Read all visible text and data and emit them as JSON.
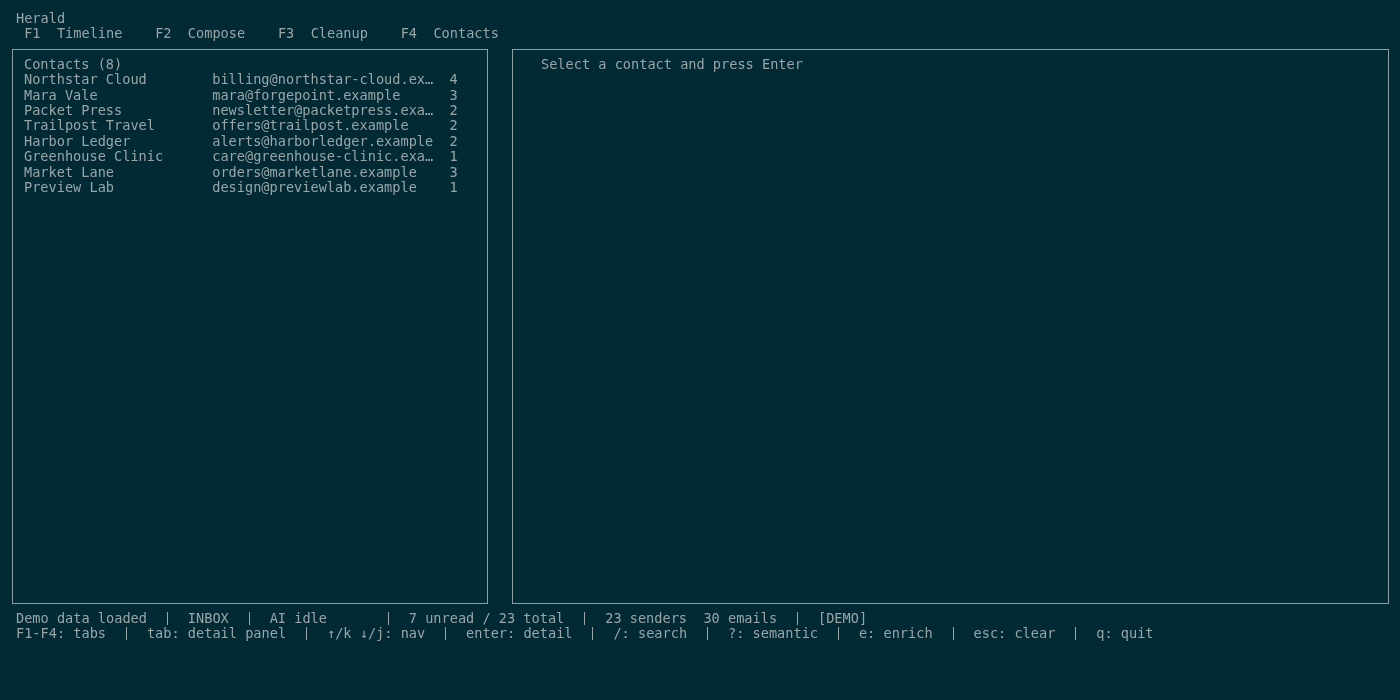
{
  "app": {
    "title": "Herald"
  },
  "tabs": [
    {
      "key": "F1",
      "label": "Timeline"
    },
    {
      "key": "F2",
      "label": "Compose"
    },
    {
      "key": "F3",
      "label": "Cleanup"
    },
    {
      "key": "F4",
      "label": "Contacts"
    }
  ],
  "contacts_panel": {
    "title": "Contacts (8)",
    "rows": [
      {
        "name": "Northstar Cloud",
        "email": "billing@northstar-cloud.ex…",
        "count": "4"
      },
      {
        "name": "Mara Vale",
        "email": "mara@forgepoint.example",
        "count": "3"
      },
      {
        "name": "Packet Press",
        "email": "newsletter@packetpress.exa…",
        "count": "2"
      },
      {
        "name": "Trailpost Travel",
        "email": "offers@trailpost.example",
        "count": "2"
      },
      {
        "name": "Harbor Ledger",
        "email": "alerts@harborledger.example",
        "count": "2"
      },
      {
        "name": "Greenhouse Clinic",
        "email": "care@greenhouse-clinic.exa…",
        "count": "1"
      },
      {
        "name": "Market Lane",
        "email": "orders@marketlane.example",
        "count": "3"
      },
      {
        "name": "Preview Lab",
        "email": "design@previewlab.example",
        "count": "1"
      }
    ]
  },
  "detail_panel": {
    "message": "Select a contact and press Enter"
  },
  "status_bar": {
    "message": "Demo data loaded",
    "mailbox": "INBOX",
    "ai_status": "AI idle",
    "unread": "7 unread / 23 total",
    "senders": "23 senders",
    "emails": "30 emails",
    "mode": "[DEMO]"
  },
  "key_hints": [
    "F1-F4: tabs",
    "tab: detail panel",
    "↑/k ↓/j: nav",
    "enter: detail",
    "/: search",
    "?: semantic",
    "e: enrich",
    "esc: clear",
    "q: quit"
  ]
}
